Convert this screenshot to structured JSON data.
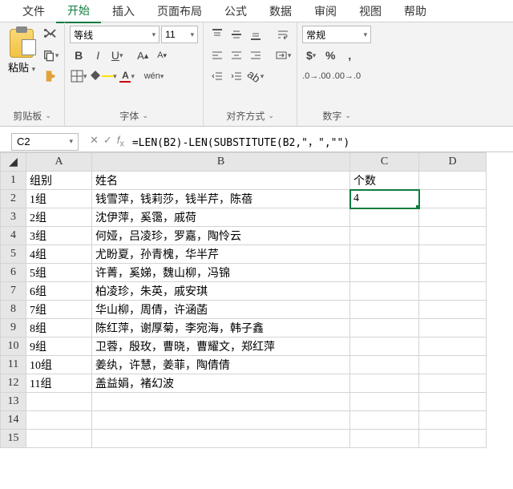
{
  "menu": {
    "items": [
      "文件",
      "开始",
      "插入",
      "页面布局",
      "公式",
      "数据",
      "审阅",
      "视图",
      "帮助"
    ],
    "active": 1
  },
  "ribbon": {
    "clipboard": {
      "label": "剪贴板",
      "paste": "粘贴"
    },
    "font": {
      "label": "字体",
      "name": "等线",
      "size": "11"
    },
    "align": {
      "label": "对齐方式"
    },
    "number": {
      "label": "数字",
      "format": "常规"
    }
  },
  "namebox": "C2",
  "formula": "=LEN(B2)-LEN(SUBSTITUTE(B2,\"，\",\"\")",
  "columns": [
    "A",
    "B",
    "C",
    "D"
  ],
  "header_row": {
    "A": "组别",
    "B": "姓名",
    "C": "个数"
  },
  "selected_value": "4",
  "rows": [
    {
      "A": "1组",
      "B": "钱雪萍，钱莉莎，钱半芹，陈蓓"
    },
    {
      "A": "2组",
      "B": "沈伊萍，奚霭，戚荷"
    },
    {
      "A": "3组",
      "B": "何娅，吕凌珍，罗嘉，陶怜云"
    },
    {
      "A": "4组",
      "B": "尤盼夏，孙青槐，华半芹"
    },
    {
      "A": "5组",
      "B": "许菁，奚娣，魏山柳，冯锦"
    },
    {
      "A": "6组",
      "B": "柏凌珍，朱英，戚安琪"
    },
    {
      "A": "7组",
      "B": "华山柳，周倩，许涵菡"
    },
    {
      "A": "8组",
      "B": "陈红萍，谢厚菊，李宛海，韩子鑫"
    },
    {
      "A": "9组",
      "B": "卫蓉，殷玫，曹晓，曹耀文，郑红萍"
    },
    {
      "A": "10组",
      "B": "姜纨，许慧，姜菲，陶倩倩"
    },
    {
      "A": "11组",
      "B": "盖益娟，褚幻波"
    }
  ],
  "empty_rows": 3
}
